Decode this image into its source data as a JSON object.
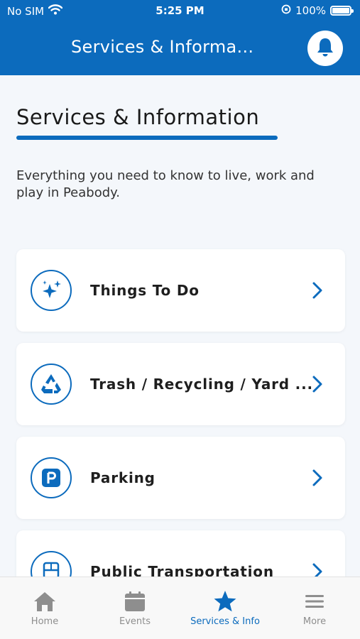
{
  "status_bar": {
    "carrier": "No SIM",
    "time": "5:25 PM",
    "battery": "100%"
  },
  "header": {
    "title": "Services & Informa...",
    "bell_icon": "bell-icon"
  },
  "page": {
    "title": "Services & Information",
    "intro": "Everything you need to know to live, work and play in Peabody."
  },
  "cards": [
    {
      "label": "Things To Do",
      "icon": "sparkles-icon"
    },
    {
      "label": "Trash / Recycling / Yard ...",
      "icon": "recycle-icon"
    },
    {
      "label": "Parking",
      "icon": "parking-icon"
    },
    {
      "label": "Public Transportation",
      "icon": "bus-icon"
    }
  ],
  "tabs": [
    {
      "label": "Home",
      "icon": "home-icon",
      "active": false
    },
    {
      "label": "Events",
      "icon": "calendar-icon",
      "active": false
    },
    {
      "label": "Services & Info",
      "icon": "star-icon",
      "active": true
    },
    {
      "label": "More",
      "icon": "menu-icon",
      "active": false
    }
  ],
  "colors": {
    "brand": "#0c6bbd",
    "background": "#f4f7fb",
    "tab_inactive": "#8e8e8e"
  }
}
